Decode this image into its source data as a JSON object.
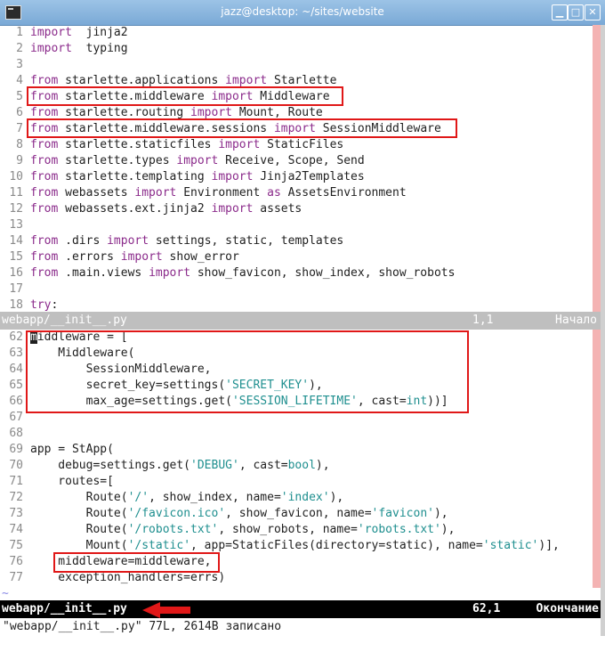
{
  "window": {
    "title": "jazz@desktop: ~/sites/website"
  },
  "pane1": {
    "status": {
      "filename": "webapp/__init__.py",
      "position": "1,1",
      "percent": "Начало"
    }
  },
  "pane2": {
    "status": {
      "filename": "webapp/__init__.py",
      "position": "62,1",
      "percent": "Окончание"
    }
  },
  "command_line": "\"webapp/__init__.py\" 77L, 2614B записано",
  "colors": {
    "keyword": "#8b2b8b",
    "string": "#1f8f8f",
    "highlight_box": "#e01818",
    "line_number": "#8a8a8a"
  },
  "top_lines": [
    {
      "n": "1",
      "t": [
        [
          "kw",
          "import"
        ],
        [
          "",
          "  jinja2"
        ]
      ]
    },
    {
      "n": "2",
      "t": [
        [
          "kw",
          "import"
        ],
        [
          "",
          "  typing"
        ]
      ]
    },
    {
      "n": "3",
      "t": []
    },
    {
      "n": "4",
      "t": [
        [
          "kw",
          "from"
        ],
        [
          "",
          " starlette.applications "
        ],
        [
          "kw",
          "import"
        ],
        [
          "",
          " Starlette"
        ]
      ]
    },
    {
      "n": "5",
      "t": [
        [
          "kw",
          "from"
        ],
        [
          "",
          " starlette.middleware "
        ],
        [
          "kw",
          "import"
        ],
        [
          "",
          " Middleware"
        ]
      ]
    },
    {
      "n": "6",
      "t": [
        [
          "kw",
          "from"
        ],
        [
          "",
          " starlette.routing "
        ],
        [
          "kw",
          "import"
        ],
        [
          "",
          " Mount, Route"
        ]
      ]
    },
    {
      "n": "7",
      "t": [
        [
          "kw",
          "from"
        ],
        [
          "",
          " starlette.middleware.sessions "
        ],
        [
          "kw",
          "import"
        ],
        [
          "",
          " SessionMiddleware"
        ]
      ]
    },
    {
      "n": "8",
      "t": [
        [
          "kw",
          "from"
        ],
        [
          "",
          " starlette.staticfiles "
        ],
        [
          "kw",
          "import"
        ],
        [
          "",
          " StaticFiles"
        ]
      ]
    },
    {
      "n": "9",
      "t": [
        [
          "kw",
          "from"
        ],
        [
          "",
          " starlette.types "
        ],
        [
          "kw",
          "import"
        ],
        [
          "",
          " Receive, Scope, Send"
        ]
      ]
    },
    {
      "n": "10",
      "t": [
        [
          "kw",
          "from"
        ],
        [
          "",
          " starlette.templating "
        ],
        [
          "kw",
          "import"
        ],
        [
          "",
          " Jinja2Templates"
        ]
      ]
    },
    {
      "n": "11",
      "t": [
        [
          "kw",
          "from"
        ],
        [
          "",
          " webassets "
        ],
        [
          "kw",
          "import"
        ],
        [
          "",
          " Environment "
        ],
        [
          "kw",
          "as"
        ],
        [
          "",
          " AssetsEnvironment"
        ]
      ]
    },
    {
      "n": "12",
      "t": [
        [
          "kw",
          "from"
        ],
        [
          "",
          " webassets.ext.jinja2 "
        ],
        [
          "kw",
          "import"
        ],
        [
          "",
          " assets"
        ]
      ]
    },
    {
      "n": "13",
      "t": []
    },
    {
      "n": "14",
      "t": [
        [
          "kw",
          "from"
        ],
        [
          "",
          " .dirs "
        ],
        [
          "kw",
          "import"
        ],
        [
          "",
          " settings, static, templates"
        ]
      ]
    },
    {
      "n": "15",
      "t": [
        [
          "kw",
          "from"
        ],
        [
          "",
          " .errors "
        ],
        [
          "kw",
          "import"
        ],
        [
          "",
          " show_error"
        ]
      ]
    },
    {
      "n": "16",
      "t": [
        [
          "kw",
          "from"
        ],
        [
          "",
          " .main.views "
        ],
        [
          "kw",
          "import"
        ],
        [
          "",
          " show_favicon, show_index, show_robots"
        ]
      ]
    },
    {
      "n": "17",
      "t": []
    },
    {
      "n": "18",
      "t": [
        [
          "kw",
          "try"
        ],
        [
          "",
          ":"
        ]
      ]
    }
  ],
  "bottom_lines": [
    {
      "n": "62",
      "t": [
        [
          "cursor",
          "m"
        ],
        [
          "",
          "iddleware = ["
        ]
      ]
    },
    {
      "n": "63",
      "t": [
        [
          "",
          "    Middleware("
        ]
      ]
    },
    {
      "n": "64",
      "t": [
        [
          "",
          "        SessionMiddleware,"
        ]
      ]
    },
    {
      "n": "65",
      "t": [
        [
          "",
          "        secret_key=settings("
        ],
        [
          "str",
          "'SECRET_KEY'"
        ],
        [
          "",
          "),"
        ]
      ]
    },
    {
      "n": "66",
      "t": [
        [
          "",
          "        max_age=settings.get("
        ],
        [
          "str",
          "'SESSION_LIFETIME'"
        ],
        [
          "",
          ", cast="
        ],
        [
          "bi",
          "int"
        ],
        [
          "",
          "))]"
        ]
      ]
    },
    {
      "n": "67",
      "t": []
    },
    {
      "n": "68",
      "t": []
    },
    {
      "n": "69",
      "t": [
        [
          "",
          "app = StApp("
        ]
      ]
    },
    {
      "n": "70",
      "t": [
        [
          "",
          "    debug=settings.get("
        ],
        [
          "str",
          "'DEBUG'"
        ],
        [
          "",
          ", cast="
        ],
        [
          "bi",
          "bool"
        ],
        [
          "",
          "),"
        ]
      ]
    },
    {
      "n": "71",
      "t": [
        [
          "",
          "    routes=["
        ]
      ]
    },
    {
      "n": "72",
      "t": [
        [
          "",
          "        Route("
        ],
        [
          "str",
          "'/'"
        ],
        [
          "",
          ", show_index, name="
        ],
        [
          "str",
          "'index'"
        ],
        [
          "",
          "),"
        ]
      ]
    },
    {
      "n": "73",
      "t": [
        [
          "",
          "        Route("
        ],
        [
          "str",
          "'/favicon.ico'"
        ],
        [
          "",
          ", show_favicon, name="
        ],
        [
          "str",
          "'favicon'"
        ],
        [
          "",
          "),"
        ]
      ]
    },
    {
      "n": "74",
      "t": [
        [
          "",
          "        Route("
        ],
        [
          "str",
          "'/robots.txt'"
        ],
        [
          "",
          ", show_robots, name="
        ],
        [
          "str",
          "'robots.txt'"
        ],
        [
          "",
          "),"
        ]
      ]
    },
    {
      "n": "75",
      "t": [
        [
          "",
          "        Mount("
        ],
        [
          "str",
          "'/static'"
        ],
        [
          "",
          ", app=StaticFiles(directory=static), name="
        ],
        [
          "str",
          "'static'"
        ],
        [
          "",
          ")],"
        ]
      ]
    },
    {
      "n": "76",
      "t": [
        [
          "",
          "    middleware=middleware,"
        ]
      ]
    },
    {
      "n": "77",
      "t": [
        [
          "",
          "    exception_handlers=errs)"
        ]
      ]
    }
  ],
  "empty_marker": "~"
}
